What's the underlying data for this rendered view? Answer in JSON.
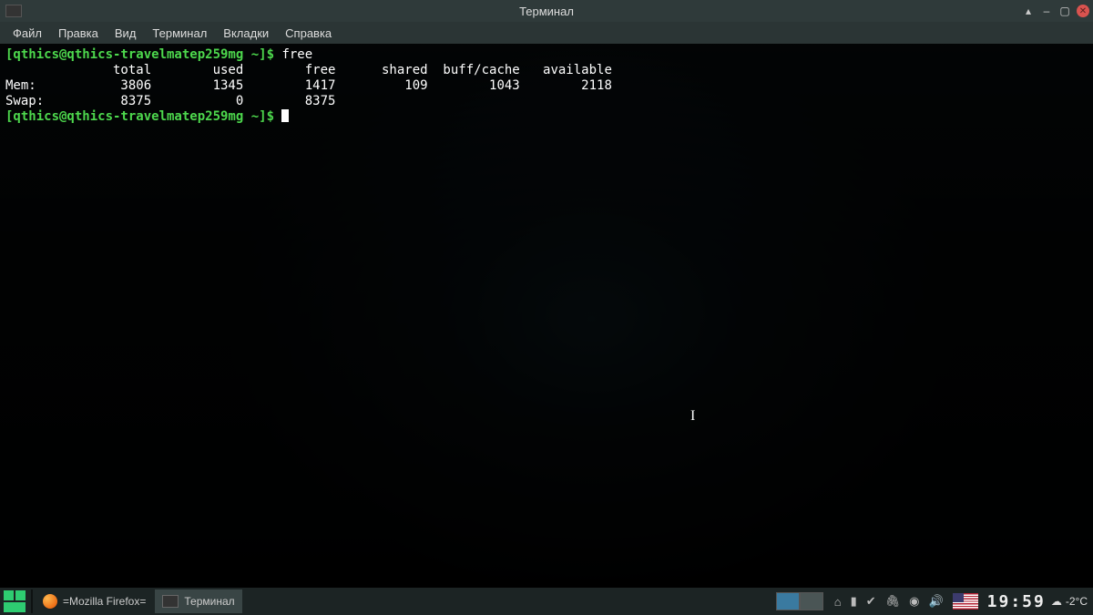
{
  "window": {
    "title": "Терминал",
    "menu": [
      "Файл",
      "Правка",
      "Вид",
      "Терминал",
      "Вкладки",
      "Справка"
    ]
  },
  "terminal": {
    "prompt": "[qthics@qthics-travelmatep259mg ~]$ ",
    "command": "free",
    "header": "              total        used        free      shared  buff/cache   available",
    "mem": "Mem:           3806        1345        1417         109        1043        2118",
    "swap": "Swap:          8375           0        8375"
  },
  "panel": {
    "task_firefox": "=Mozilla Firefox=",
    "task_terminal": "Терминал",
    "clock": "19:59",
    "temperature": "-2°C"
  }
}
